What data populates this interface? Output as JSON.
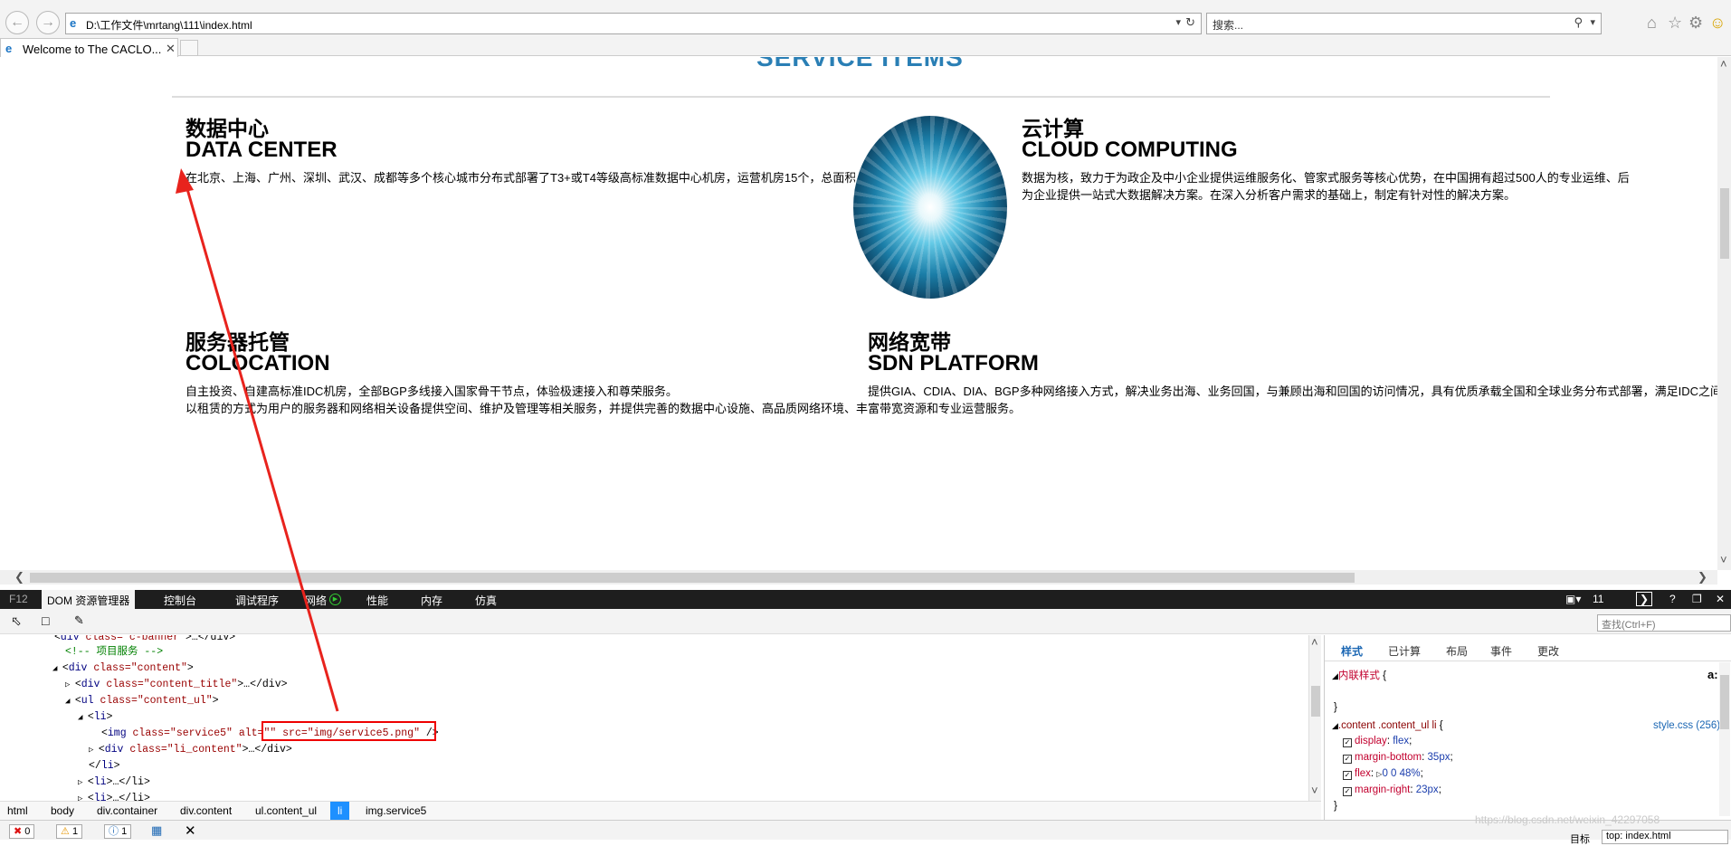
{
  "browser": {
    "address": "D:\\工作文件\\mrtang\\111\\index.html",
    "search_placeholder": "搜索...",
    "tab_title": "Welcome to The CACLO..."
  },
  "page": {
    "section_title": "SERVICE ITEMS",
    "services": [
      {
        "cn": "数据中心",
        "en": "DATA CENTER",
        "desc": "在北京、上海、广州、深圳、武汉、成都等多个核心城市分布式部署了T3+或T4等级高标准数据中心机房，运营机房15个，总面积"
      },
      {
        "cn": "云计算",
        "en": "CLOUD COMPUTING",
        "desc1": "数据为核，致力于为政企及中小企业提供运维服务化、管家式服务等核心优势，在中国拥有超过500人的专业运维、后",
        "desc2": "为企业提供一站式大数据解决方案。在深入分析客户需求的基础上，制定有针对性的解决方案。"
      },
      {
        "cn": "服务器托管",
        "en": "COLOCATION",
        "desc1": "自主投资、自建高标准IDC机房，全部BGP多线接入国家骨干节点，体验极速接入和尊荣服务。",
        "desc2": "以租赁的方式为用户的服务器和网络相关设备提供空间、维护及管理等相关服务，并提供完善的数据中心设施、高品质网络环境、丰富带宽资源和专业运营服务。"
      },
      {
        "cn": "网络宽带",
        "en": "SDN PLATFORM",
        "desc": "提供GIA、CDIA、DIA、BGP多种网络接入方式，解决业务出海、业务回国，与兼顾出海和回国的访问情况，具有优质承载全国和全球业务分布式部署，满足IDC之间"
      }
    ]
  },
  "devtools": {
    "f12": "F12",
    "tabs": [
      "DOM 资源管理器",
      "控制台",
      "调试程序",
      "网络",
      "性能",
      "内存",
      "仿真"
    ],
    "doc_mode": "11",
    "find_placeholder": "查找(Ctrl+F)",
    "dom_lines": [
      {
        "pre": "<",
        "tag": "div",
        "attrs": " class=\"c-banner\"",
        "post": ">…</div>"
      },
      {
        "comment": "<!-- 项目服务 -->"
      },
      {
        "pre": "<",
        "tag": "div",
        "attrs": " class=\"content\"",
        "post": ">"
      },
      {
        "pre": "<",
        "tag": "div",
        "attrs": " class=\"content_title\"",
        "post": ">…</div>"
      },
      {
        "pre": "<",
        "tag": "ul",
        "attrs": " class=\"content_ul\"",
        "post": ">"
      },
      {
        "pre": "<",
        "tag": "li",
        "attrs": "",
        "post": ">"
      },
      {
        "pre": "<",
        "tag": "img",
        "attrs": " class=\"service5\" alt=\"\" src=\"img/service5.png\"",
        "post": " />"
      },
      {
        "pre": "<",
        "tag": "div",
        "attrs": " class=\"li_content\"",
        "post": ">…</div>"
      },
      {
        "pre": "</",
        "tag": "li",
        "attrs": "",
        "post": ">"
      },
      {
        "pre": "<",
        "tag": "li",
        "attrs": "",
        "post": ">…</li>"
      },
      {
        "pre": "<",
        "tag": "li",
        "attrs": "",
        "post": ">…</li>"
      }
    ],
    "breadcrumb": [
      "html",
      "body",
      "div.container",
      "div.content",
      "ul.content_ul",
      "li",
      "img.service5"
    ],
    "style_tabs": [
      "样式",
      "已计算",
      "布局",
      "事件",
      "更改"
    ],
    "inline_style": "内联样式",
    "rule_selector": ".content .content_ul li",
    "rule_source": "style.css (256)",
    "rule_props": [
      {
        "name": "display",
        "value": "flex"
      },
      {
        "name": "margin-bottom",
        "value": "35px"
      },
      {
        "name": "flex",
        "value": "0 0 48%"
      },
      {
        "name": "margin-right",
        "value": "23px"
      }
    ],
    "status": {
      "errors": "0",
      "warnings": "1",
      "info": "1",
      "target_label": "目标",
      "target_value": "top: index.html"
    },
    "watermark": "https://blog.csdn.net/weixin_42297058"
  }
}
